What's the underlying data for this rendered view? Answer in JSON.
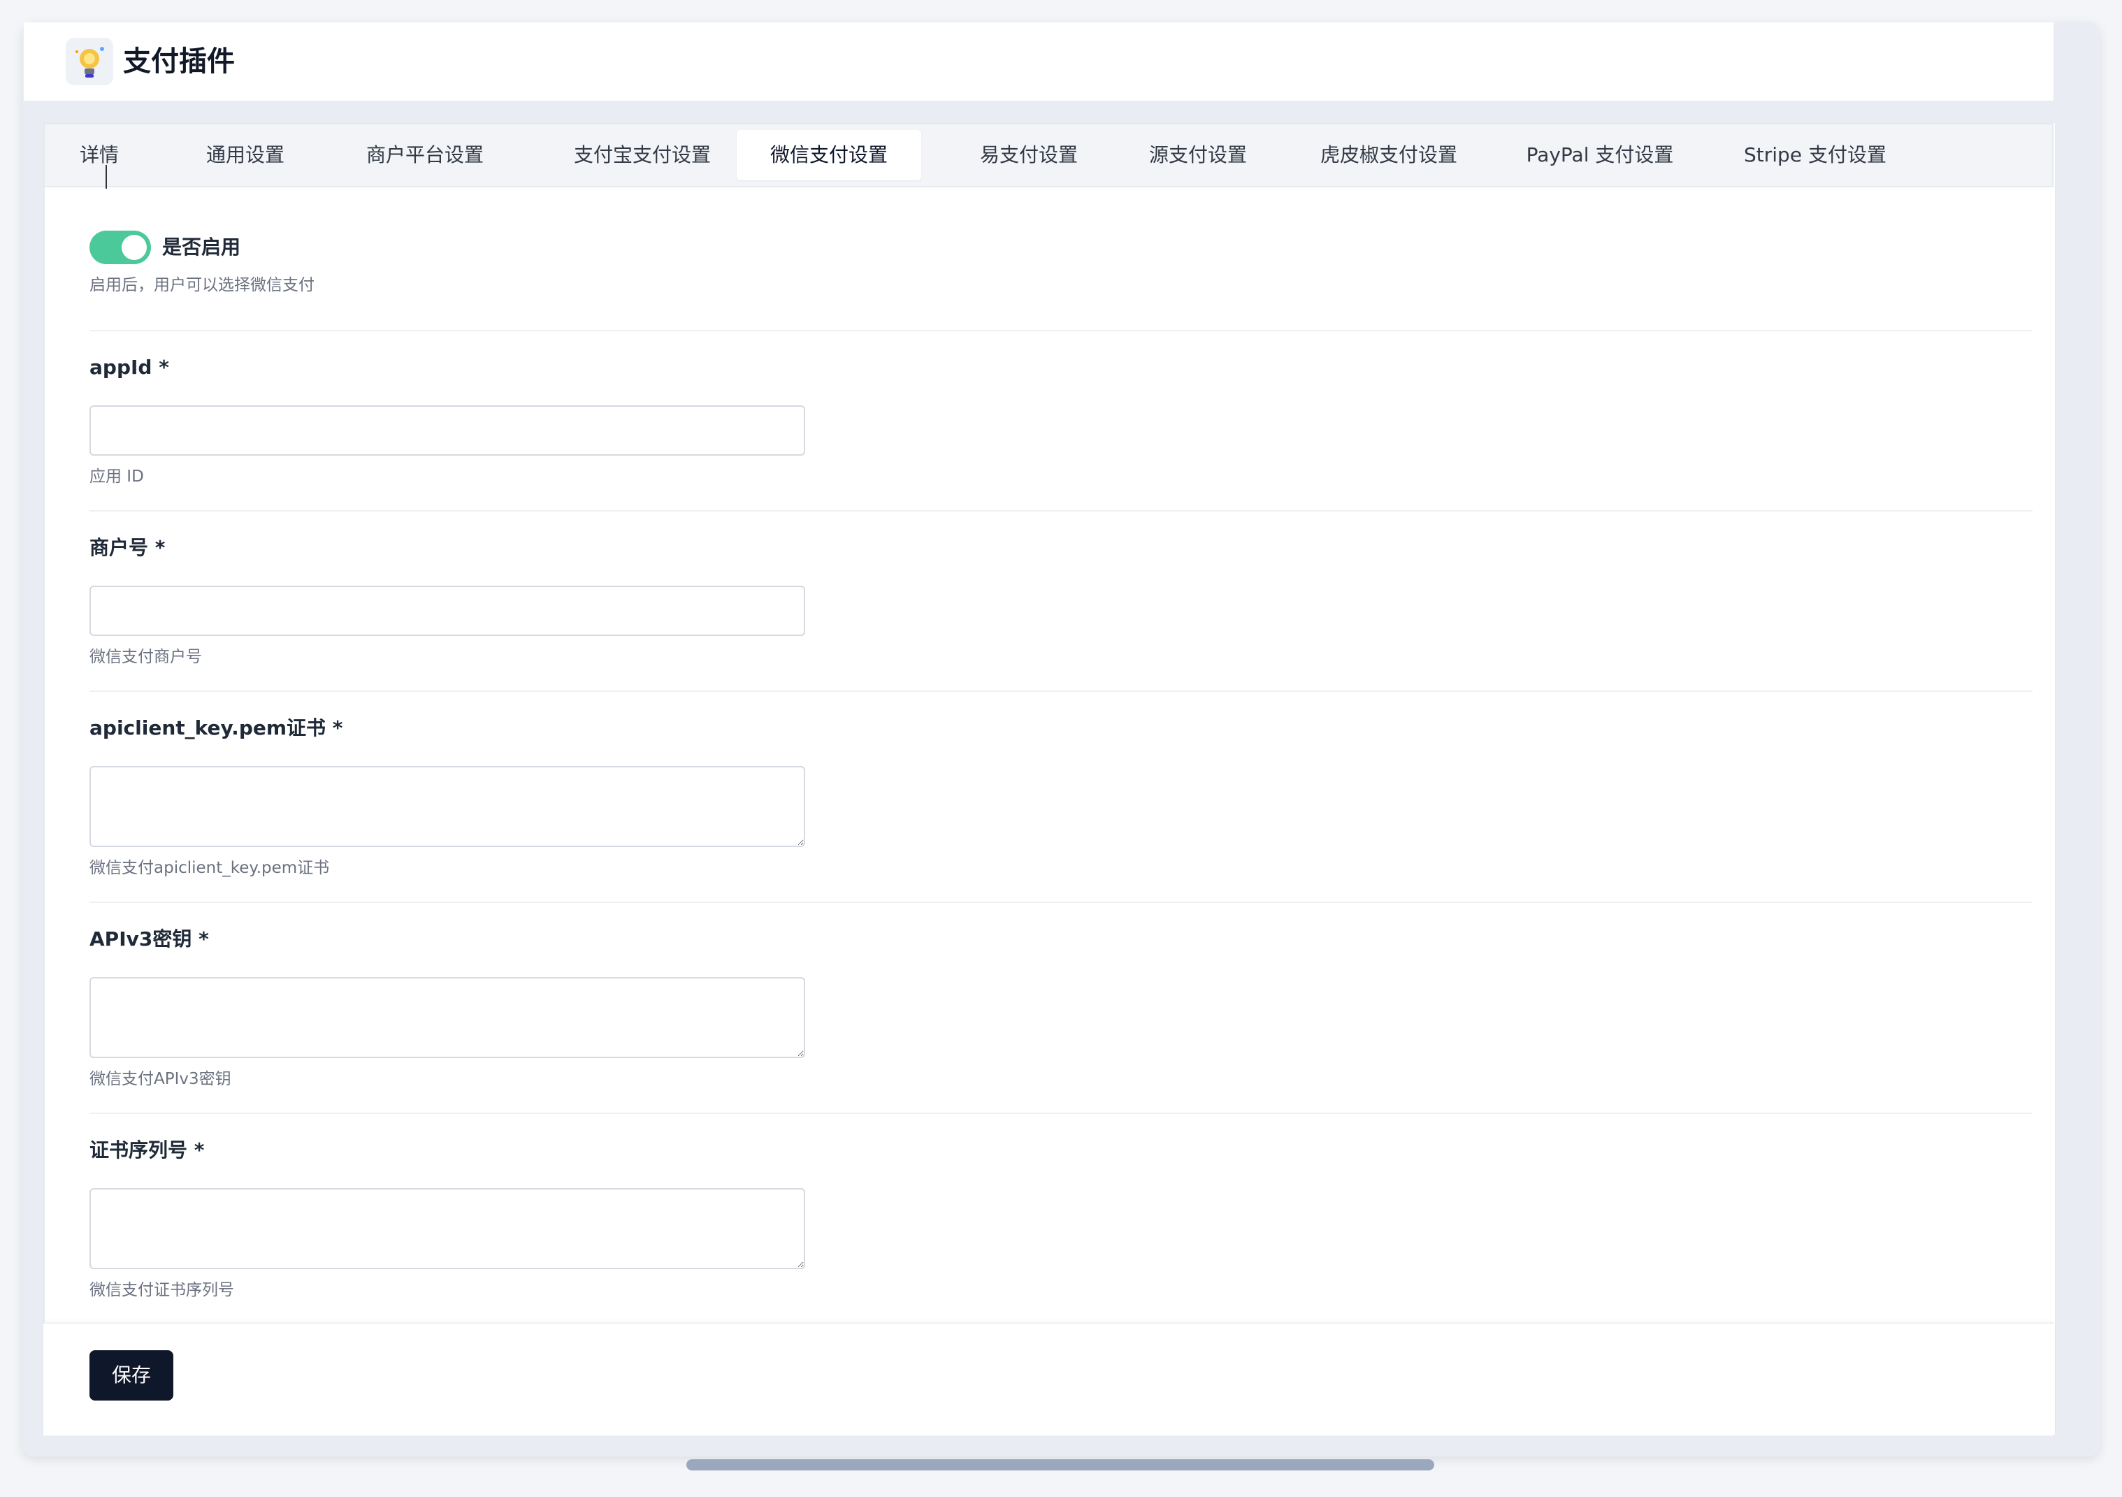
{
  "app": {
    "title": "支付插件",
    "logo_icon": "lightbulb-icon"
  },
  "tabs": [
    {
      "label": "详情"
    },
    {
      "label": "通用设置"
    },
    {
      "label": "商户平台设置"
    },
    {
      "label": "支付宝支付设置"
    },
    {
      "label": "微信支付设置",
      "active": true
    },
    {
      "label": "易支付设置"
    },
    {
      "label": "源支付设置"
    },
    {
      "label": "虎皮椒支付设置"
    },
    {
      "label": "PayPal 支付设置"
    },
    {
      "label": "Stripe 支付设置"
    }
  ],
  "form": {
    "enable": {
      "label": "是否启用",
      "hint": "启用后，用户可以选择微信支付",
      "on": true
    },
    "appid": {
      "label": "appId *",
      "value": "",
      "hint": "应用 ID"
    },
    "merchant_no": {
      "label": "商户号 *",
      "value": "",
      "hint": "微信支付商户号"
    },
    "apiclient_key": {
      "label": "apiclient_key.pem证书 *",
      "value": "",
      "hint": "微信支付apiclient_key.pem证书"
    },
    "apiv3_key": {
      "label": "APIv3密钥 *",
      "value": "",
      "hint": "微信支付APIv3密钥"
    },
    "cert_serial": {
      "label": "证书序列号 *",
      "value": "",
      "hint": "微信支付证书序列号"
    }
  },
  "footer": {
    "save_label": "保存"
  },
  "colors": {
    "accent": "#4bc99a",
    "primary_button": "#0f172a"
  }
}
